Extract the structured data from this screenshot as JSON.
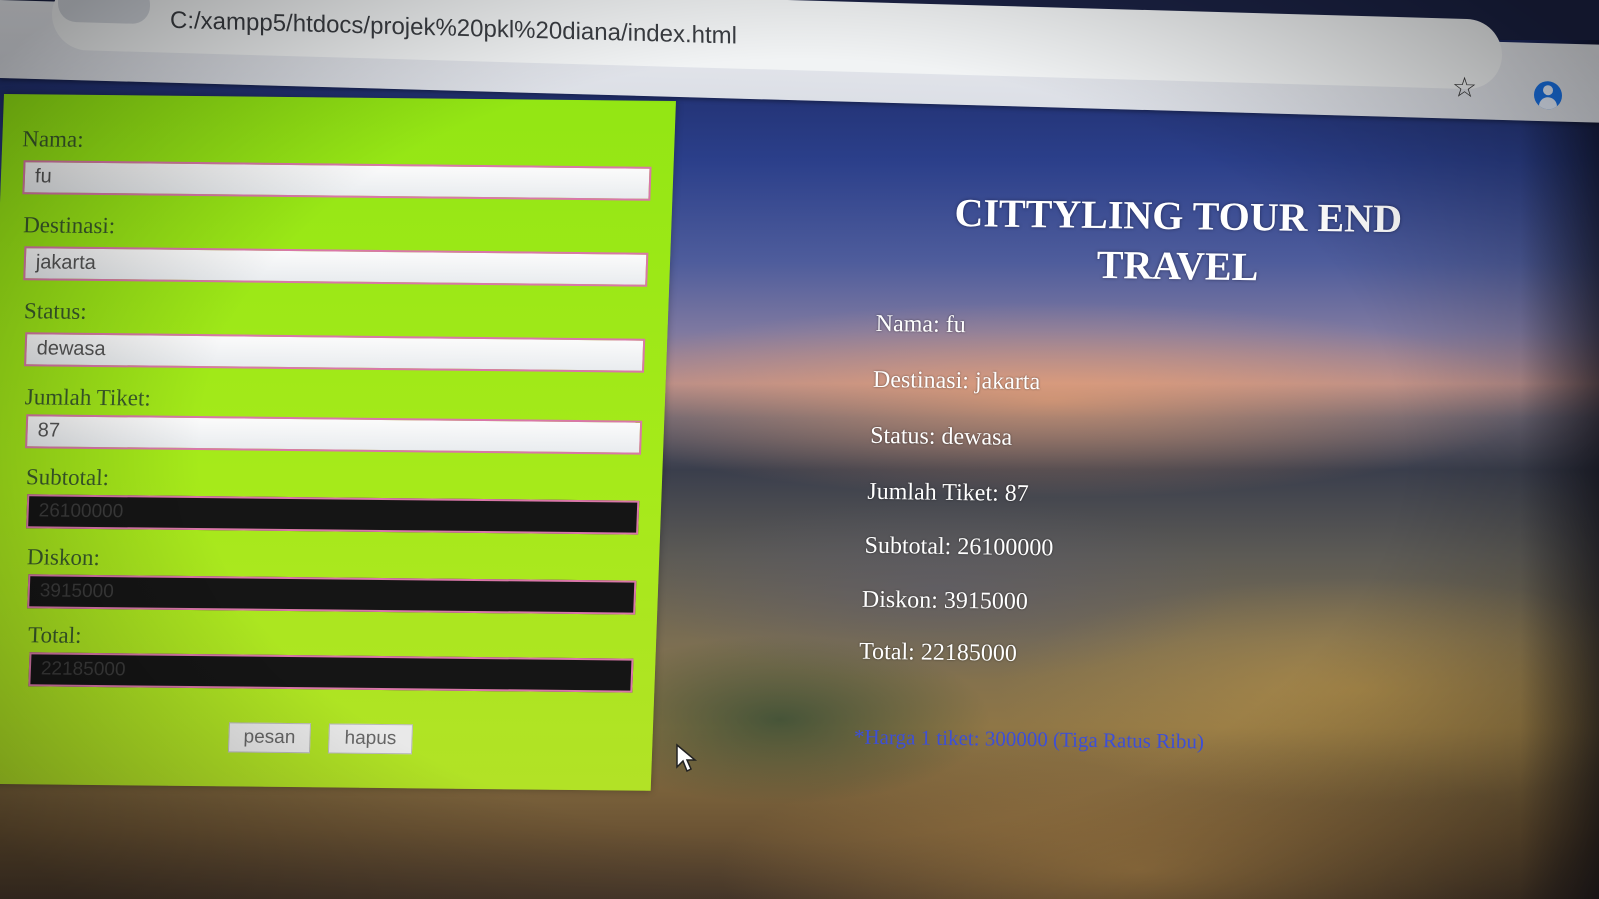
{
  "browser": {
    "url": "C:/xampp5/htdocs/projek%20pkl%20diana/index.html",
    "bookmark_icon": "star-icon",
    "profile_icon": "account-icon"
  },
  "form": {
    "nama": {
      "label": "Nama:",
      "value": "fu"
    },
    "destinasi": {
      "label": "Destinasi:",
      "value": "jakarta"
    },
    "status": {
      "label": "Status:",
      "value": "dewasa"
    },
    "jumlah_tiket": {
      "label": "Jumlah Tiket:",
      "value": "87"
    },
    "subtotal": {
      "label": "Subtotal:",
      "value": "26100000"
    },
    "diskon": {
      "label": "Diskon:",
      "value": "3915000"
    },
    "total": {
      "label": "Total:",
      "value": "22185000"
    },
    "buttons": {
      "pesan": "pesan",
      "hapus": "hapus"
    },
    "colors": {
      "panel": "#9be616",
      "field_border": "#d977a8",
      "readonly_field": "#151515"
    }
  },
  "summary": {
    "title": "CITTYLING TOUR END TRAVEL",
    "nama": "Nama: fu",
    "destinasi": "Destinasi: jakarta",
    "status": "Status: dewasa",
    "jumlah_tiket": "Jumlah Tiket: 87",
    "subtotal": "Subtotal: 26100000",
    "diskon": "Diskon: 3915000",
    "total": "Total: 22185000",
    "price_note": "*Harga 1 tiket: 300000 (Tiga Ratus Ribu)",
    "colors": {
      "text": "#ffffff",
      "note": "#3d4fd6"
    }
  }
}
